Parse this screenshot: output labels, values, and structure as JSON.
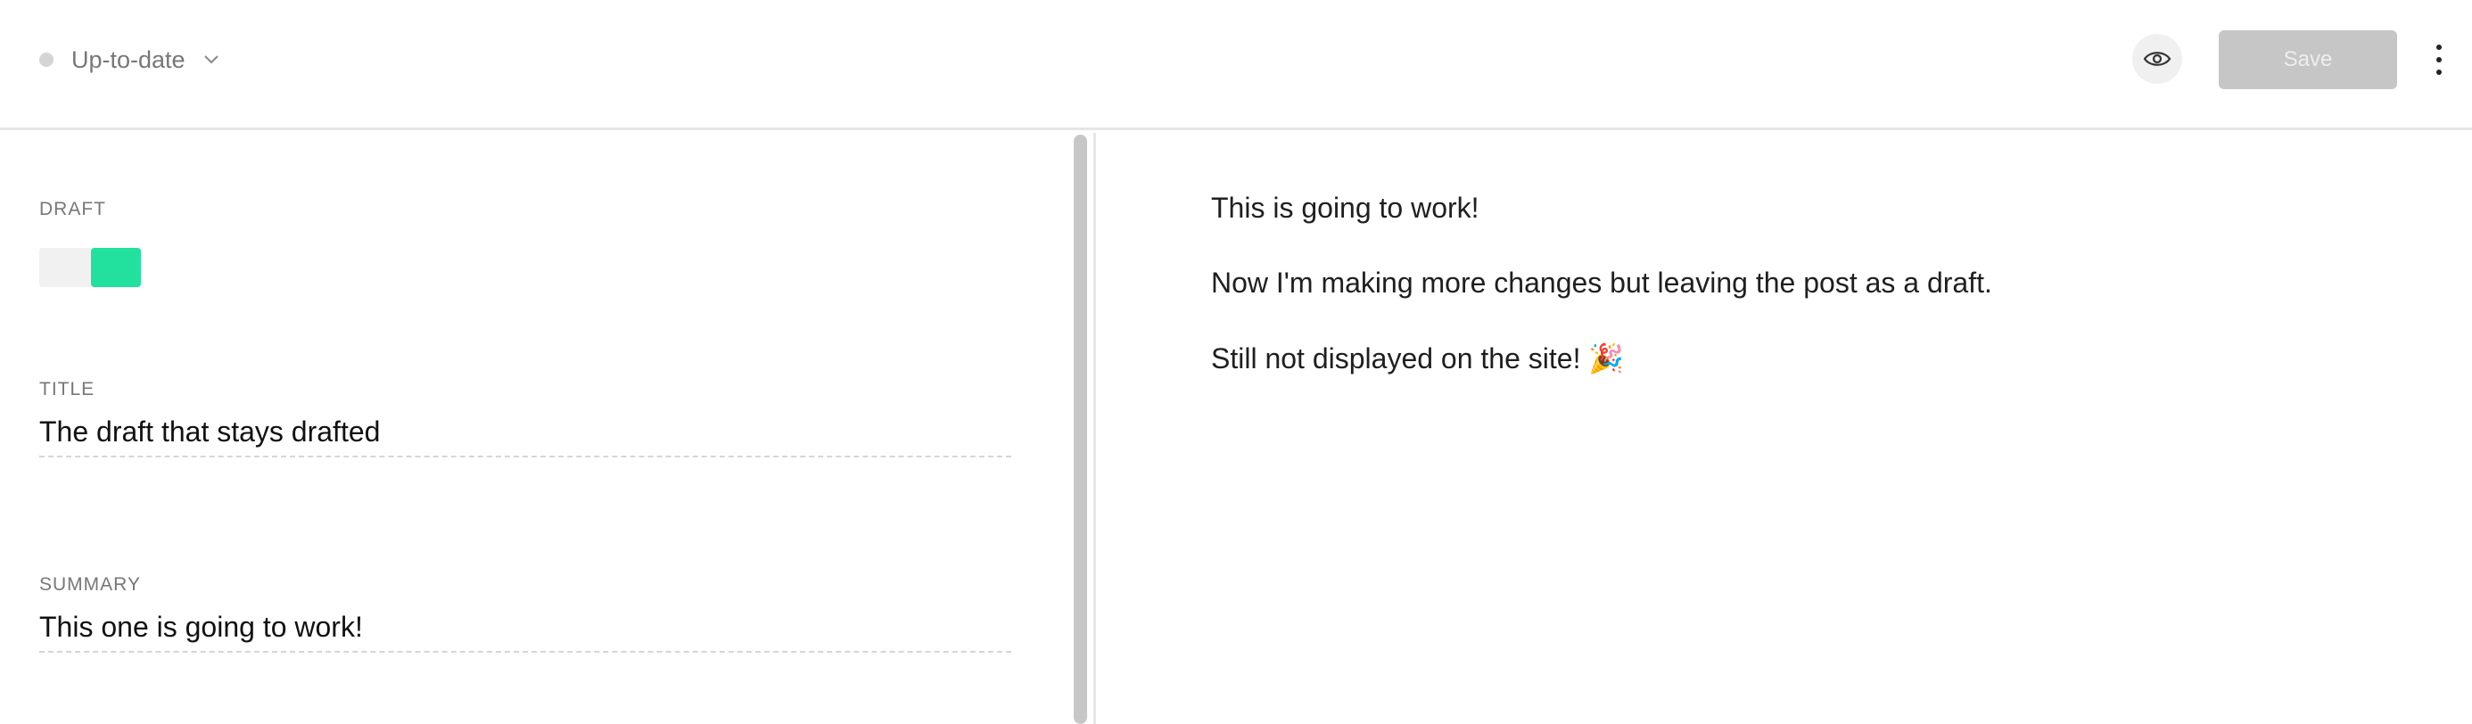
{
  "header": {
    "status_label": "Up-to-date",
    "status_dot_color": "#d4d4d4",
    "save_label": "Save"
  },
  "editor": {
    "draft_label": "DRAFT",
    "draft_toggle_on": true,
    "toggle_accent": "#22e09d",
    "title_label": "TITLE",
    "title_value": "The draft that stays drafted",
    "summary_label": "SUMMARY",
    "summary_value": "This one is going to work!"
  },
  "preview": {
    "paragraphs": [
      "This is going to work!",
      "Now I'm making more changes but leaving the post as a draft.",
      "Still not displayed on the site! 🎉"
    ]
  },
  "icons": {
    "chevron": "chevron-down-icon",
    "preview": "eye-icon",
    "more": "more-vertical-icon"
  }
}
